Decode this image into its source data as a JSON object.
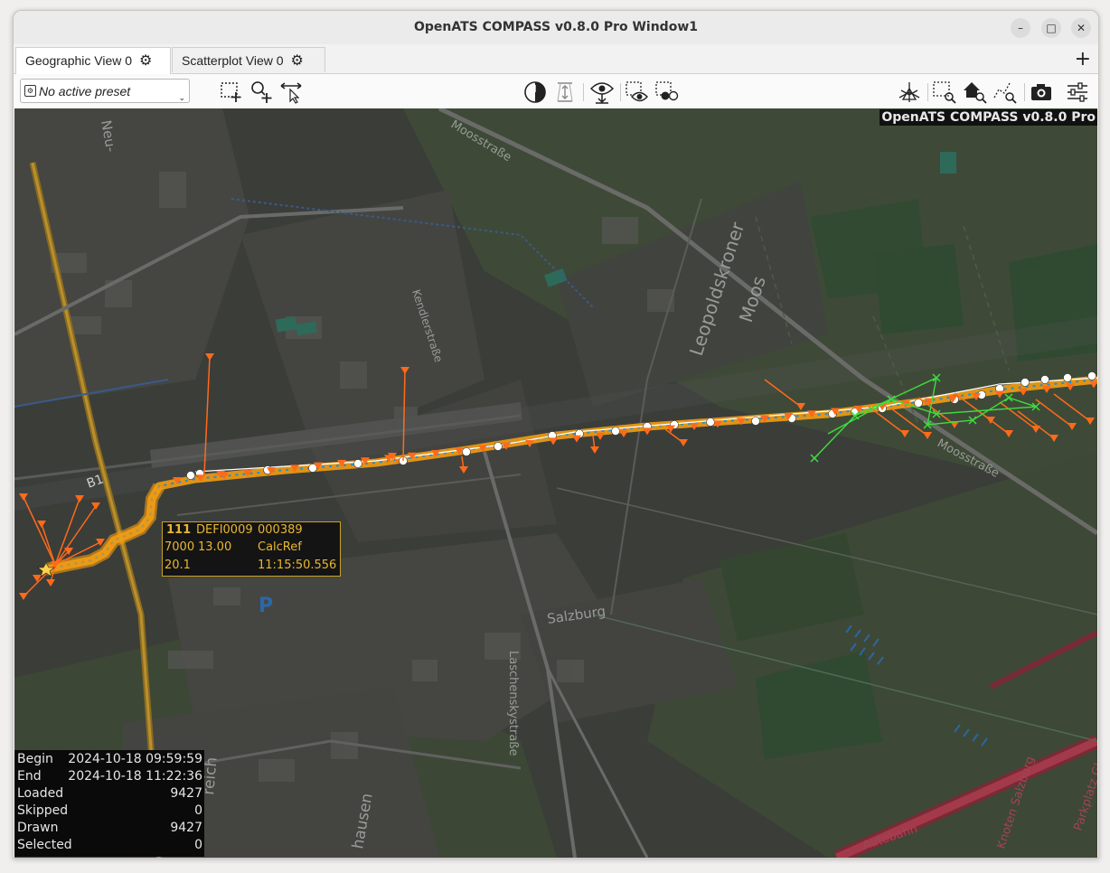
{
  "window": {
    "title": "OpenATS COMPASS v0.8.0 Pro Window1",
    "controls": [
      "minimize",
      "maximize",
      "close"
    ]
  },
  "tabs": [
    {
      "label": "Geographic View 0",
      "icon": "gear-icon",
      "active": true
    },
    {
      "label": "Scatterplot View 0",
      "icon": "gear-icon",
      "active": false
    }
  ],
  "toolbar": {
    "preset_placeholder": "No active preset",
    "left_tools": [
      "select-rect-icon",
      "zoom-add-icon",
      "pan-icon"
    ],
    "center_tools": [
      "time-window-icon",
      "altitude-filter-icon",
      "eye-load-icon",
      "select-eye-icon",
      "select-dots-icon"
    ],
    "right_tools": [
      "3d-view-icon",
      "zoom-rect-icon",
      "home-zoom-icon",
      "track-zoom-icon",
      "screenshot-icon",
      "settings-sliders-icon"
    ]
  },
  "map": {
    "watermark": "OpenATS COMPASS v0.8.0 Pro",
    "labels": {
      "mossstrasse_top": "Moosstraße",
      "leopoldskroner": "Leopoldskroner",
      "moos": "Moos",
      "kendlerstrasse": "Kendlerstraße",
      "mossstrasse_right": "Moosstraße",
      "salzburg": "Salzburg",
      "laschenskystrasse": "Laschenskystraße",
      "knoten": "Knoten Salzburg",
      "parkplatz": "Parkplatz Glanegg",
      "autobahn": "Autobahn",
      "b1": "B1",
      "neu": "Neu-",
      "parking": "P",
      "reich": "reich",
      "hausen": "hausen"
    },
    "colors": {
      "track_orange": "#f39c12",
      "track_white": "#ffffff",
      "track_blue": "#1e90d6",
      "outlier_orange": "#ff6a1a",
      "green": "#3fdc3f"
    }
  },
  "target_info": {
    "mode3a": "111",
    "callsign": "DEFI0009",
    "address": "000389",
    "code": "7000",
    "fl": "13.00",
    "source": "CalcRef",
    "speed": "20.1",
    "time": "11:15:50.556"
  },
  "stats": [
    {
      "key": "Begin",
      "value": "2024-10-18 09:59:59"
    },
    {
      "key": "End",
      "value": "2024-10-18 11:22:36"
    },
    {
      "key": "Loaded",
      "value": "9427"
    },
    {
      "key": "Skipped",
      "value": "0"
    },
    {
      "key": "Drawn",
      "value": "9427"
    },
    {
      "key": "Selected",
      "value": "0"
    }
  ]
}
